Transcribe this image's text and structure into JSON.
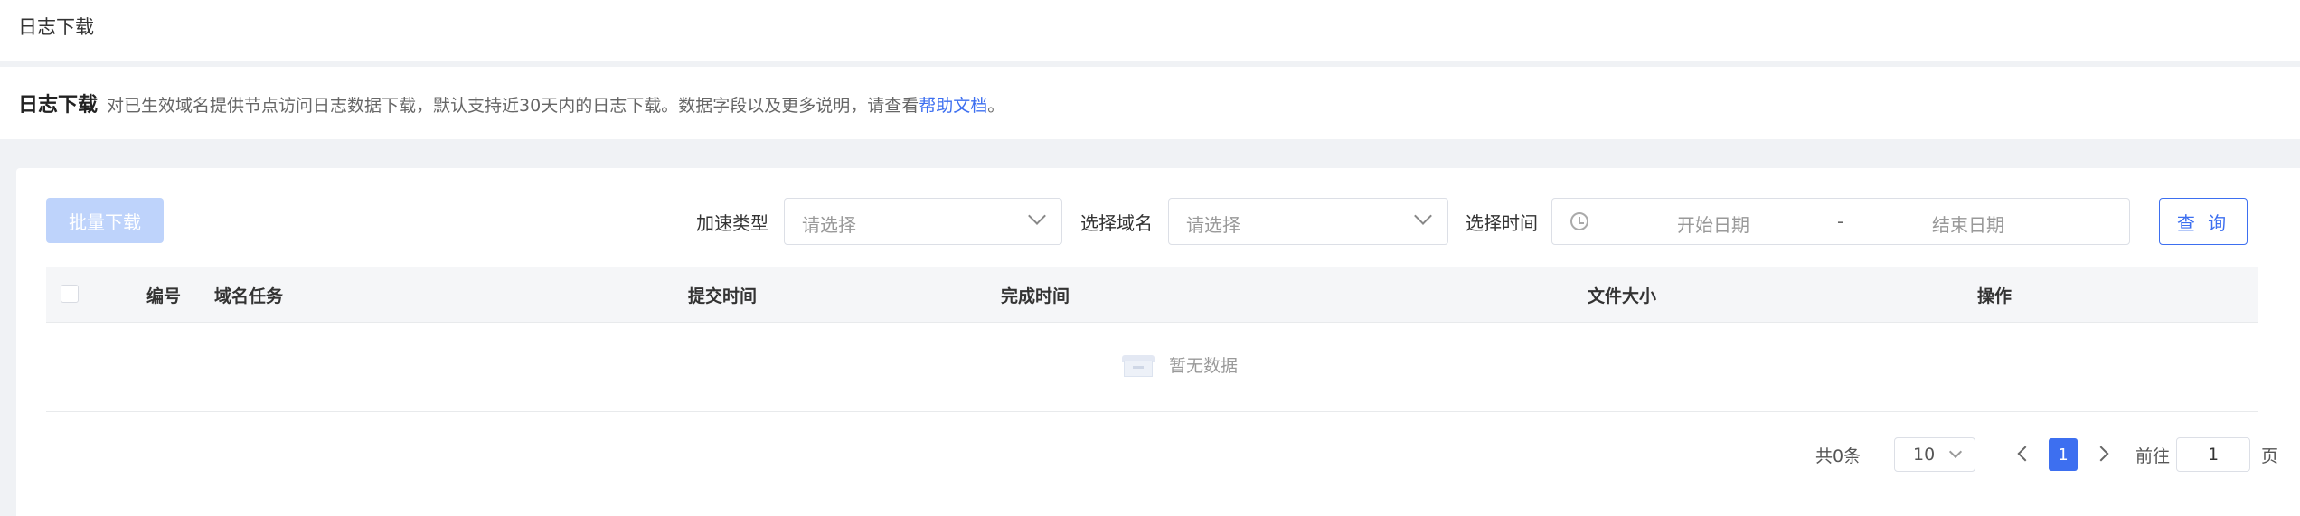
{
  "header": {
    "title": "日志下载"
  },
  "description": {
    "strong": "日志下载",
    "text": "对已生效域名提供节点访问日志数据下载，默认支持近30天内的日志下载。数据字段以及更多说明，请查看",
    "link": "帮助文档",
    "suffix": "。"
  },
  "toolbar": {
    "batch_download": "批量下载",
    "accel_type_label": "加速类型",
    "accel_type_placeholder": "请选择",
    "domain_label": "选择域名",
    "domain_placeholder": "请选择",
    "time_label": "选择时间",
    "start_placeholder": "开始日期",
    "range_separator": "-",
    "end_placeholder": "结束日期",
    "query_button": "查 询"
  },
  "table": {
    "columns": [
      "编号",
      "域名任务",
      "提交时间",
      "完成时间",
      "文件大小",
      "操作"
    ],
    "rows": [],
    "empty_text": "暂无数据"
  },
  "pagination": {
    "total": "共0条",
    "page_size": "10",
    "current_page": "1",
    "goto_label": "前往",
    "goto_value": "1",
    "page_suffix": "页"
  },
  "colors": {
    "primary": "#3d6ff0",
    "disabled_button": "#bed3fb",
    "background": "#f0f2f5"
  }
}
